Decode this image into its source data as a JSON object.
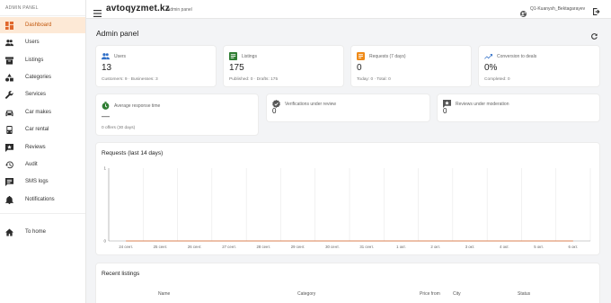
{
  "sidebar": {
    "header": "ADMIN PANEL",
    "items": [
      {
        "label": "Dashboard",
        "icon": "dashboard-icon",
        "active": true
      },
      {
        "label": "Users",
        "icon": "users-icon"
      },
      {
        "label": "Listings",
        "icon": "listings-icon"
      },
      {
        "label": "Categories",
        "icon": "categories-icon"
      },
      {
        "label": "Services",
        "icon": "wrench-icon"
      },
      {
        "label": "Car makes",
        "icon": "car-icon"
      },
      {
        "label": "Car rental",
        "icon": "car-rental-icon"
      },
      {
        "label": "Reviews",
        "icon": "reviews-icon"
      },
      {
        "label": "Audit",
        "icon": "history-icon"
      },
      {
        "label": "SMS logs",
        "icon": "sms-icon"
      },
      {
        "label": "Notifications",
        "icon": "bell-icon"
      },
      {
        "label": "To home",
        "icon": "home-icon"
      }
    ]
  },
  "topbar": {
    "brand": "avtoqyzmet.kz",
    "subtitle": "Admin panel",
    "user": "Q1-Kuanysh_Bektagarayev"
  },
  "page": {
    "title": "Admin panel"
  },
  "stats": [
    {
      "label": "Users",
      "value": "13",
      "sub": "Customers: 9 · Businesses: 3",
      "icon": "users-icon",
      "color": "#2f6fc7"
    },
    {
      "label": "Listings",
      "value": "175",
      "sub": "Published: 0 · Drafts: 175",
      "icon": "listings-icon",
      "color": "#2e7d32"
    },
    {
      "label": "Requests (7 days)",
      "value": "0",
      "sub": "Today: 0 · Total: 0",
      "icon": "requests-icon",
      "color": "#ef8a17"
    },
    {
      "label": "Conversion to deals",
      "value": "0%",
      "sub": "Completed: 0",
      "icon": "trend-icon",
      "color": "#2f6fc7"
    }
  ],
  "stats2": [
    {
      "label": "Average response time",
      "value": "—",
      "sub": "0 offers (30 days)",
      "icon": "timer-icon",
      "color": "#2e7d32"
    },
    {
      "label": "Verifications under review",
      "value": "0",
      "sub": "",
      "icon": "verified-icon",
      "color": "#555555"
    },
    {
      "label": "Reviews under moderation",
      "value": "0",
      "sub": "",
      "icon": "reviews-icon",
      "color": "#555555"
    }
  ],
  "chart": {
    "title": "Requests (last 14 days)"
  },
  "chart_data": {
    "type": "line",
    "title": "Requests (last 14 days)",
    "categories": [
      "24 сент.",
      "25 сент.",
      "26 сент.",
      "27 сент.",
      "28 сент.",
      "29 сент.",
      "30 сент.",
      "31 сент.",
      "1 окт.",
      "2 окт.",
      "3 окт.",
      "4 окт.",
      "5 окт.",
      "6 окт."
    ],
    "series": [
      {
        "values": [
          0,
          0,
          0,
          0,
          0,
          0,
          0,
          0,
          0,
          0,
          0,
          0,
          0,
          0
        ]
      }
    ],
    "yticks": [
      "0",
      "1"
    ],
    "ylim": [
      0,
      1
    ],
    "grid": true
  },
  "recent": {
    "title": "Recent listings",
    "columns": [
      "Name",
      "Category",
      "Price from",
      "City",
      "Status"
    ]
  },
  "colors": {
    "accent": "#e0672b",
    "active_bg": "#fde9d6"
  }
}
